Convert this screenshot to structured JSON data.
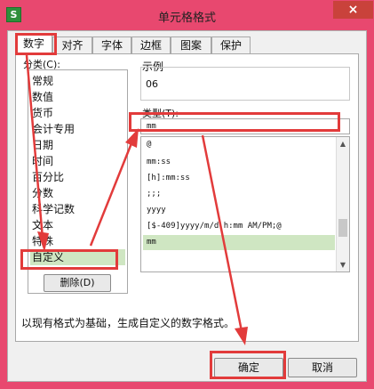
{
  "window": {
    "title": "单元格格式",
    "app_icon": "S",
    "close_label": "×"
  },
  "tabs": [
    "数字",
    "对齐",
    "字体",
    "边框",
    "图案",
    "保护"
  ],
  "category": {
    "label": "分类(C):",
    "items": [
      "常规",
      "数值",
      "货币",
      "会计专用",
      "日期",
      "时间",
      "百分比",
      "分数",
      "科学记数",
      "文本",
      "特殊",
      "自定义"
    ],
    "selected": "自定义"
  },
  "delete_button": "删除(D)",
  "example": {
    "label": "示例",
    "value": "06"
  },
  "type": {
    "label": "类型(T):",
    "value": "mm",
    "items": [
      "@",
      "mm:ss",
      "[h]:mm:ss",
      ";;;",
      "yyyy",
      "[$-409]yyyy/m/d h:mm AM/PM;@",
      "mm"
    ],
    "selected": "mm"
  },
  "description": "以现有格式为基础，生成自定义的数字格式。",
  "ok_button": "确定",
  "cancel_button": "取消",
  "annotation_color": "#e23b3b",
  "selection_color": "#cfe6c2",
  "titlebar_color": "#e8486f"
}
